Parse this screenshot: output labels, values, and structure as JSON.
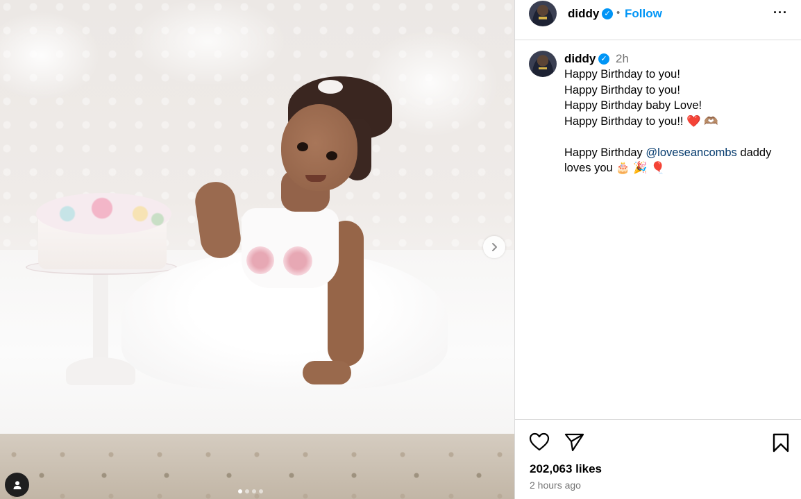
{
  "post": {
    "carousel": {
      "slide_count": 4,
      "active_index": 0
    },
    "image_icons": {
      "next": "chevron-right-icon",
      "tag": "user-icon"
    }
  },
  "header": {
    "username": "diddy",
    "verified_icon": "verified-badge-icon",
    "separator": "•",
    "follow_label": "Follow",
    "more_label": "···"
  },
  "caption": {
    "username": "diddy",
    "time": "2h",
    "lines": [
      "Happy Birthday to you!",
      "Happy Birthday to you!",
      "Happy Birthday baby Love!",
      "Happy Birthday to you!! ❤️ 🫶🏽"
    ],
    "line5_prefix": "Happy Birthday ",
    "mention": "@loveseancombs",
    "line5_suffix": " daddy",
    "line6": "loves you 🎂 🎉 🎈"
  },
  "actions": {
    "like_icon": "heart-icon",
    "share_icon": "send-icon",
    "save_icon": "bookmark-icon",
    "likes": "202,063 likes",
    "time_ago": "2 hours ago"
  },
  "colors": {
    "accent": "#0095f6",
    "mention": "#00376b",
    "muted": "#737373",
    "border": "#dbdbdb"
  }
}
